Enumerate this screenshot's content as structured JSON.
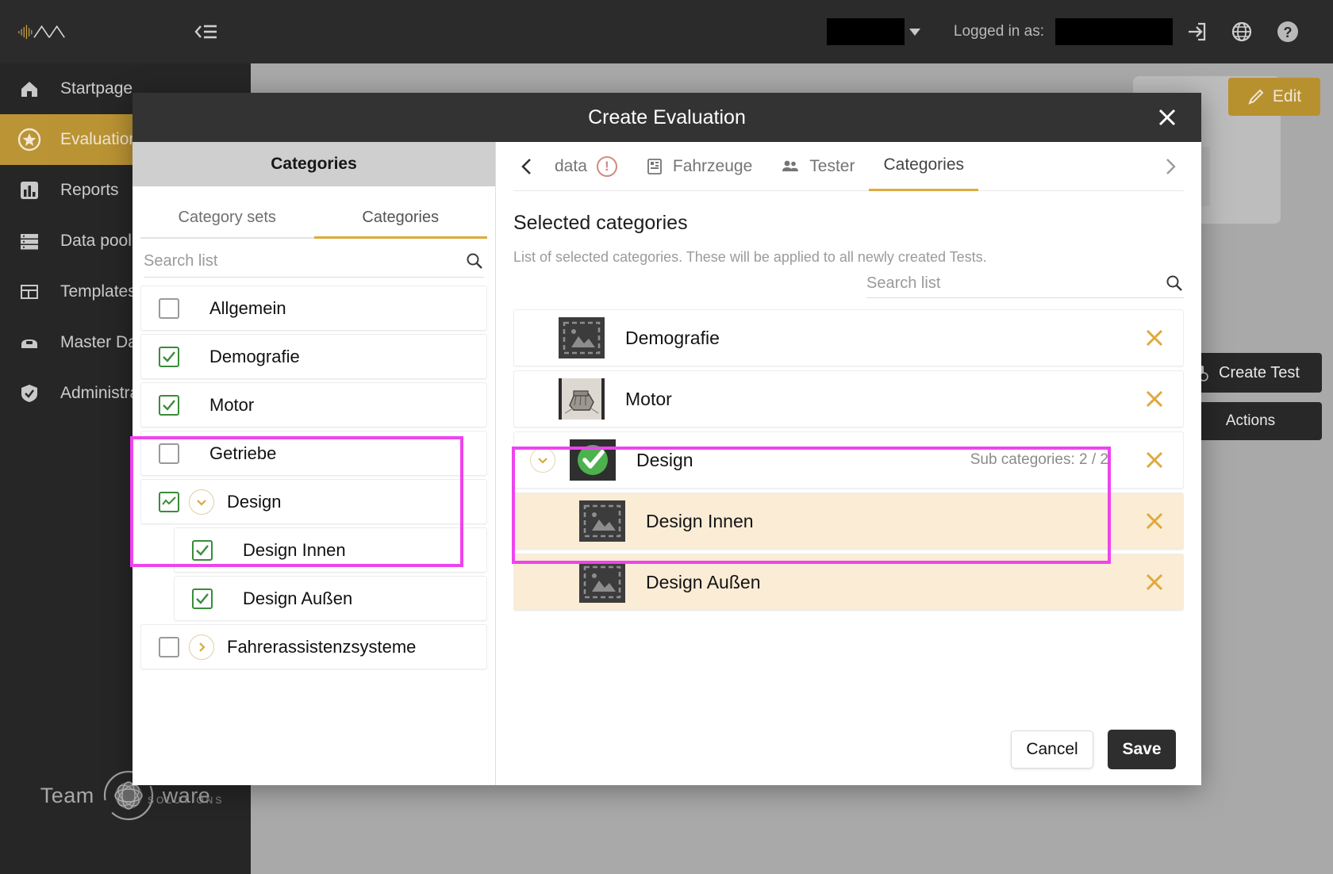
{
  "topbar": {
    "logged_in_label": "Logged in as:",
    "icons": [
      "logout-icon",
      "globe-icon",
      "help-icon"
    ]
  },
  "sidebar": {
    "items": [
      {
        "label": "Startpage",
        "icon": "home-icon",
        "active": false
      },
      {
        "label": "Evaluations",
        "icon": "star-icon",
        "active": true
      },
      {
        "label": "Reports",
        "icon": "chart-icon",
        "active": false
      },
      {
        "label": "Data pool",
        "icon": "database-icon",
        "active": false
      },
      {
        "label": "Templates",
        "icon": "template-icon",
        "active": false
      },
      {
        "label": "Master Data",
        "icon": "masterdata-icon",
        "active": false
      },
      {
        "label": "Administration",
        "icon": "shield-icon",
        "active": false
      }
    ],
    "footer_logo": {
      "team": "Team",
      "ware": "ware",
      "solutions": "SOLUTIONS"
    }
  },
  "background": {
    "edit_button": "Edit",
    "create_test_button": "Create Test",
    "actions_button": "Actions"
  },
  "modal": {
    "title": "Create Evaluation",
    "close_icon": "close-icon",
    "tabs": [
      {
        "label": "data",
        "icon": "",
        "active": false,
        "warning": true
      },
      {
        "label": "Fahrzeuge",
        "icon": "vehicle-icon",
        "active": false,
        "warning": false
      },
      {
        "label": "Tester",
        "icon": "people-icon",
        "active": false,
        "warning": false
      },
      {
        "label": "Categories",
        "icon": "",
        "active": true,
        "warning": false
      }
    ],
    "footer": {
      "cancel": "Cancel",
      "save": "Save"
    }
  },
  "categories_panel": {
    "header": "Categories",
    "tabs": [
      {
        "label": "Category sets",
        "active": false
      },
      {
        "label": "Categories",
        "active": true
      }
    ],
    "search_placeholder": "Search list",
    "search_value": "",
    "items": [
      {
        "label": "Allgemein",
        "checked": "none",
        "expandable": false,
        "level": 0
      },
      {
        "label": "Demografie",
        "checked": "full",
        "expandable": false,
        "level": 0
      },
      {
        "label": "Motor",
        "checked": "full",
        "expandable": false,
        "level": 0
      },
      {
        "label": "Getriebe",
        "checked": "none",
        "expandable": false,
        "level": 0
      },
      {
        "label": "Design",
        "checked": "partial",
        "expandable": true,
        "expanded": true,
        "level": 0,
        "highlighted": true
      },
      {
        "label": "Design Innen",
        "checked": "full",
        "expandable": false,
        "level": 1,
        "highlighted": true
      },
      {
        "label": "Design Außen",
        "checked": "full",
        "expandable": false,
        "level": 1,
        "highlighted": true
      },
      {
        "label": "Fahrerassistenzsysteme",
        "checked": "none",
        "expandable": true,
        "expanded": false,
        "level": 0
      }
    ]
  },
  "selected_panel": {
    "title": "Selected categories",
    "description": "List of selected categories. These will be applied to all newly created Tests.",
    "search_placeholder": "Search list",
    "search_value": "",
    "rows": [
      {
        "label": "Demografie",
        "thumb": "image-placeholder-icon",
        "level": 0,
        "expandable": false,
        "sub_count": "",
        "remove_icon": "remove-icon"
      },
      {
        "label": "Motor",
        "thumb": "engine-photo",
        "level": 0,
        "expandable": false,
        "sub_count": "",
        "remove_icon": "remove-icon"
      },
      {
        "label": "Design",
        "thumb": "green-check-icon",
        "level": 0,
        "expandable": true,
        "sub_count": "Sub categories: 2 / 2",
        "remove_icon": "remove-icon"
      },
      {
        "label": "Design Innen",
        "thumb": "image-placeholder-icon",
        "level": 1,
        "expandable": false,
        "sub_count": "",
        "remove_icon": "remove-icon",
        "highlighted": true
      },
      {
        "label": "Design Außen",
        "thumb": "image-placeholder-icon",
        "level": 1,
        "expandable": false,
        "sub_count": "",
        "remove_icon": "remove-icon",
        "highlighted": true
      }
    ]
  },
  "colors": {
    "accent_gold": "#b8912f",
    "tab_underline": "#ddab3c",
    "remove_x": "#e0a93c",
    "checkbox_green": "#3a8c3a",
    "highlight_magenta": "#ee44ee",
    "row_highlight_bg": "#faecd5",
    "dark": "#2b2b2b"
  }
}
